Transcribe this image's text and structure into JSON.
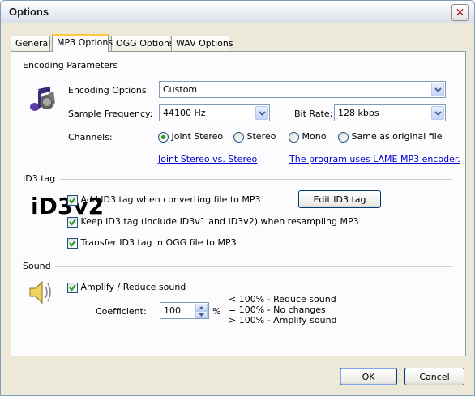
{
  "window": {
    "title": "Options",
    "close_label": "✕"
  },
  "tabs": [
    {
      "label": "General"
    },
    {
      "label": "MP3 Options"
    },
    {
      "label": "OGG Options"
    },
    {
      "label": "WAV Options"
    }
  ],
  "encoding": {
    "section_title": "Encoding Parameters",
    "encoding_options_label": "Encoding Options:",
    "encoding_options_value": "Custom",
    "sample_frequency_label": "Sample Frequency:",
    "sample_frequency_value": "44100 Hz",
    "bit_rate_label": "Bit Rate:",
    "bit_rate_value": "128 kbps",
    "channels_label": "Channels:",
    "channels": [
      {
        "label": "Joint Stereo",
        "selected": true
      },
      {
        "label": "Stereo",
        "selected": false
      },
      {
        "label": "Mono",
        "selected": false
      },
      {
        "label": "Same as original file",
        "selected": false
      }
    ],
    "link_joint_stereo": "Joint Stereo vs. Stereo",
    "link_lame": "The program uses LAME MP3 encoder."
  },
  "id3": {
    "section_title": "ID3 tag",
    "logo_text": "iD3v2",
    "add_tag_label": "Add ID3 tag when converting file to MP3",
    "keep_tag_label": "Keep ID3 tag (include ID3v1 and ID3v2) when resampling MP3",
    "transfer_tag_label": "Transfer ID3 tag in OGG file to MP3",
    "edit_button_label": "Edit ID3 tag"
  },
  "sound": {
    "section_title": "Sound",
    "amplify_label": "Amplify / Reduce sound",
    "coefficient_label": "Coefficient:",
    "coefficient_value": "100",
    "percent_sign": "%",
    "hint_lines": [
      "< 100% - Reduce sound",
      "= 100% - No changes",
      "> 100% - Amplify sound"
    ]
  },
  "footer": {
    "ok_label": "OK",
    "cancel_label": "Cancel"
  }
}
